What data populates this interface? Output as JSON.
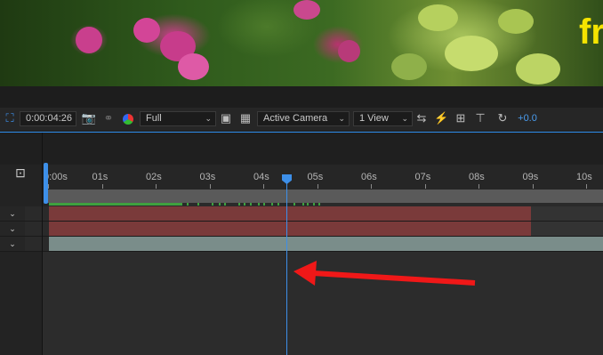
{
  "preview": {
    "overlay_text": "fr"
  },
  "toolbar": {
    "timecode": "0:00:04:26",
    "resolution": "Full",
    "camera": "Active Camera",
    "view_layout": "1 View",
    "exposure": "+0.0"
  },
  "ruler": {
    "labels": [
      "0:00s",
      "01s",
      "02s",
      "03s",
      "04s",
      "05s",
      "06s",
      "07s",
      "08s",
      "09s",
      "10s"
    ]
  },
  "layers": [
    {
      "color": "#7a3a3a"
    },
    {
      "color": "#7a3a3a"
    },
    {
      "color": "#7a8d8a"
    }
  ],
  "annotation": {
    "arrow_color": "#f01818"
  },
  "playhead": {
    "time": "0:00:04:26"
  }
}
